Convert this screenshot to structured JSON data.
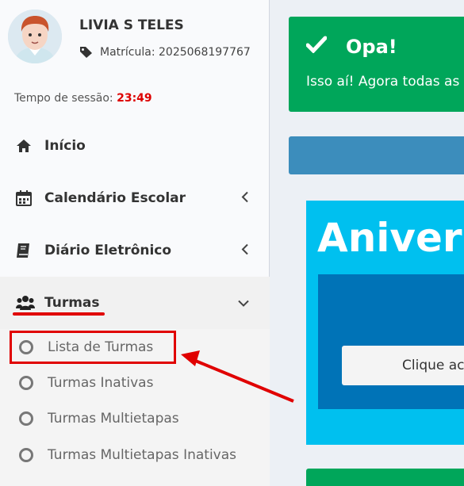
{
  "user": {
    "name": "LIVIA S TELES",
    "matricula_label": "Matrícula: 2025068197767"
  },
  "session": {
    "label": "Tempo de sessão:",
    "time": "23:49"
  },
  "menu": {
    "items": [
      {
        "label": "Início",
        "icon": "home-icon"
      },
      {
        "label": "Calendário Escolar",
        "icon": "calendar-icon"
      },
      {
        "label": "Diário Eletrônico",
        "icon": "book-icon"
      },
      {
        "label": "Turmas",
        "icon": "users-icon"
      }
    ],
    "turmas_submenu": [
      {
        "label": "Lista de Turmas"
      },
      {
        "label": "Turmas Inativas"
      },
      {
        "label": "Turmas Multietapas"
      },
      {
        "label": "Turmas Multietapas Inativas"
      }
    ]
  },
  "alert": {
    "title": "Opa!",
    "text": "Isso aí! Agora todas as"
  },
  "birthday": {
    "title": "Anivers",
    "button": "Clique ac"
  },
  "colors": {
    "success": "#00a65a",
    "primary": "#3c8dbc",
    "info": "#00c0ef",
    "annotation": "#e00000",
    "session_time": "#dd0000"
  }
}
